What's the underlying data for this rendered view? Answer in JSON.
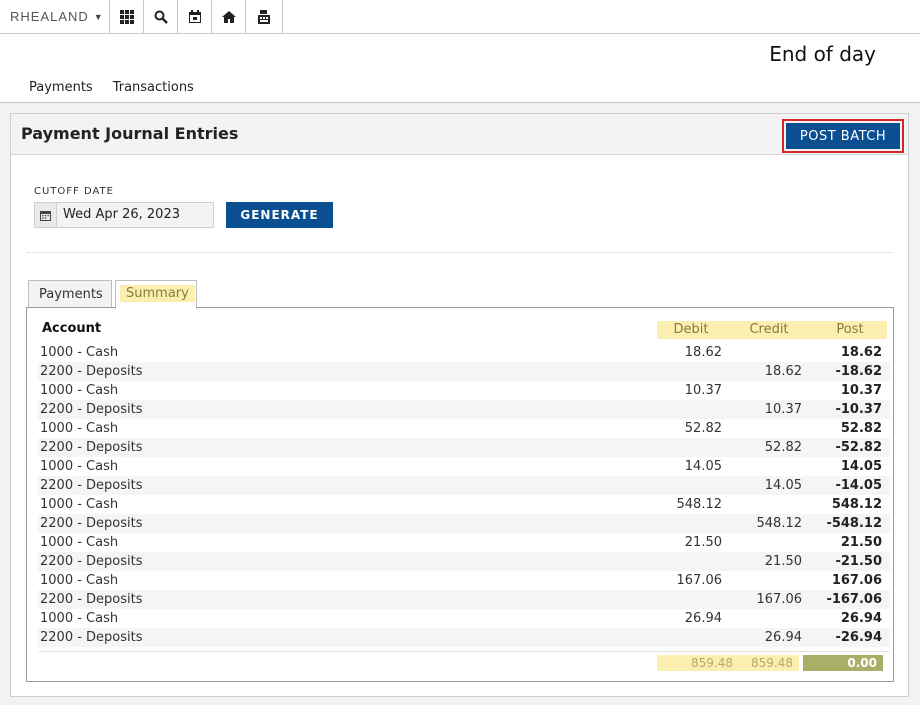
{
  "toolbar": {
    "brand": "RHEALAND",
    "buttons": [
      {
        "name": "apps-grid-icon"
      },
      {
        "name": "search-icon"
      },
      {
        "name": "calendar-icon"
      },
      {
        "name": "home-icon"
      },
      {
        "name": "register-icon"
      }
    ]
  },
  "page": {
    "title": "End of day"
  },
  "top_tabs": [
    {
      "label": "Payments",
      "active": true
    },
    {
      "label": "Transactions",
      "active": false
    }
  ],
  "panel": {
    "title": "Payment Journal Entries",
    "post_batch_label": "POST BATCH",
    "cutoff_label": "CUTOFF DATE",
    "cutoff_value": "Wed Apr 26, 2023",
    "generate_label": "GENERATE"
  },
  "sub_tabs": [
    {
      "label": "Payments",
      "active": false
    },
    {
      "label": "Summary",
      "active": true
    }
  ],
  "table": {
    "headers": {
      "account": "Account",
      "debit": "Debit",
      "credit": "Credit",
      "post": "Post"
    },
    "rows": [
      {
        "account": "1000 - Cash",
        "debit": "18.62",
        "credit": "",
        "post": "18.62"
      },
      {
        "account": "2200 - Deposits",
        "debit": "",
        "credit": "18.62",
        "post": "-18.62"
      },
      {
        "account": "1000 - Cash",
        "debit": "10.37",
        "credit": "",
        "post": "10.37"
      },
      {
        "account": "2200 - Deposits",
        "debit": "",
        "credit": "10.37",
        "post": "-10.37"
      },
      {
        "account": "1000 - Cash",
        "debit": "52.82",
        "credit": "",
        "post": "52.82"
      },
      {
        "account": "2200 - Deposits",
        "debit": "",
        "credit": "52.82",
        "post": "-52.82"
      },
      {
        "account": "1000 - Cash",
        "debit": "14.05",
        "credit": "",
        "post": "14.05"
      },
      {
        "account": "2200 - Deposits",
        "debit": "",
        "credit": "14.05",
        "post": "-14.05"
      },
      {
        "account": "1000 - Cash",
        "debit": "548.12",
        "credit": "",
        "post": "548.12"
      },
      {
        "account": "2200 - Deposits",
        "debit": "",
        "credit": "548.12",
        "post": "-548.12"
      },
      {
        "account": "1000 - Cash",
        "debit": "21.50",
        "credit": "",
        "post": "21.50"
      },
      {
        "account": "2200 - Deposits",
        "debit": "",
        "credit": "21.50",
        "post": "-21.50"
      },
      {
        "account": "1000 - Cash",
        "debit": "167.06",
        "credit": "",
        "post": "167.06"
      },
      {
        "account": "2200 - Deposits",
        "debit": "",
        "credit": "167.06",
        "post": "-167.06"
      },
      {
        "account": "1000 - Cash",
        "debit": "26.94",
        "credit": "",
        "post": "26.94"
      },
      {
        "account": "2200 - Deposits",
        "debit": "",
        "credit": "26.94",
        "post": "-26.94"
      }
    ],
    "totals": {
      "debit": "859.48",
      "credit": "859.48",
      "post": "0.00"
    }
  },
  "colors": {
    "primary": "#0b4f93",
    "active_tab": "#2aa0d8",
    "highlight": "#fbefb0",
    "total_post": "#a8b068",
    "callout": "#d6262d"
  }
}
